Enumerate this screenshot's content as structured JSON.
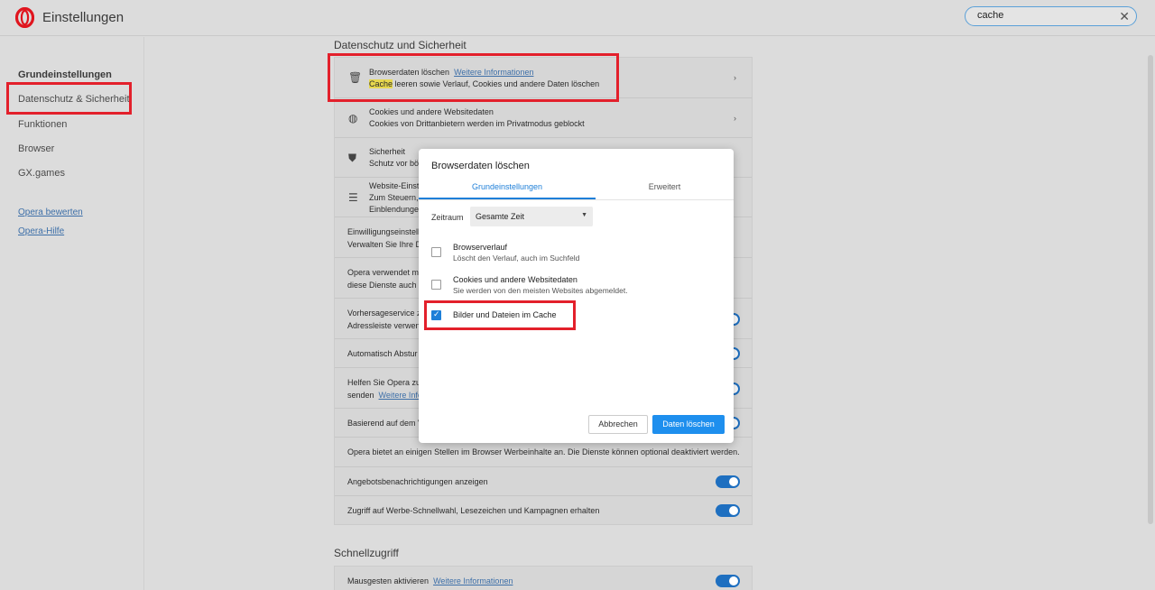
{
  "header": {
    "title": "Einstellungen",
    "search_value": "cache",
    "clear": "✕"
  },
  "sidebar": {
    "items": [
      {
        "label": "Grundeinstellungen"
      },
      {
        "label": "Datenschutz & Sicherheit"
      },
      {
        "label": "Funktionen"
      },
      {
        "label": "Browser"
      },
      {
        "label": "GX.games"
      }
    ],
    "links": [
      {
        "label": "Opera bewerten"
      },
      {
        "label": "Opera-Hilfe"
      }
    ]
  },
  "main": {
    "section1_title": "Datenschutz und Sicherheit",
    "rows": {
      "clear": {
        "title": "Browserdaten löschen",
        "link": "Weitere Informationen",
        "sub_hl": "Cache",
        "sub_rest": " leeren sowie Verlauf, Cookies und andere Daten löschen"
      },
      "cookies": {
        "title": "Cookies und andere Websitedaten",
        "sub": "Cookies von Drittanbietern werden im Privatmodus geblockt"
      },
      "security": {
        "title": "Sicherheit",
        "sub": "Schutz vor bö"
      },
      "website": {
        "l1": "Website-Einst",
        "l2": "Zum Steuern,",
        "l3": "Einblendunge"
      },
      "consent": {
        "l1": "Einwilligungseinstell",
        "l2": "Verwalten Sie Ihre D"
      },
      "opera_uses": {
        "l1": "Opera verwendet m",
        "l2": "diese Dienste auch c"
      },
      "predict": {
        "l1": "Vorhersageservice z",
        "l2": "Adressleiste verwen"
      },
      "crash": {
        "l1": "Automatisch Abstur"
      },
      "help": {
        "l1": "Helfen Sie Opera zu",
        "l2": "senden",
        "link": "Weitere Info"
      },
      "based": {
        "l1": "Basierend auf dem V"
      },
      "ads": {
        "l1": "Opera bietet an einigen Stellen im Browser Werbeinhalte an. Die Dienste können optional deaktiviert werden."
      },
      "offers": {
        "l1": "Angebotsbenachrichtigungen anzeigen"
      },
      "speed": {
        "l1": "Zugriff auf Werbe-Schnellwahl, Lesezeichen und Kampagnen erhalten"
      }
    },
    "section2_title": "Schnellzugriff",
    "gestures": {
      "l1": "Mausgesten aktivieren",
      "link": "Weitere Informationen"
    }
  },
  "dialog": {
    "title": "Browserdaten löschen",
    "tabs": [
      {
        "label": "Grundeinstellungen"
      },
      {
        "label": "Erweitert"
      }
    ],
    "range_label": "Zeitraum",
    "range_value": "Gesamte Zeit",
    "options": [
      {
        "title": "Browserverlauf",
        "sub": "Löscht den Verlauf, auch im Suchfeld",
        "checked": false
      },
      {
        "title": "Cookies und andere Websitedaten",
        "sub": "Sie werden von den meisten Websites abgemeldet.",
        "checked": false
      },
      {
        "title": "Bilder und Dateien im Cache",
        "checked": true
      }
    ],
    "cancel": "Abbrechen",
    "confirm": "Daten löschen"
  },
  "colors": {
    "accent": "#1e7fd8",
    "highlight_box": "#e3202b",
    "opera_red": "#e0151e"
  }
}
